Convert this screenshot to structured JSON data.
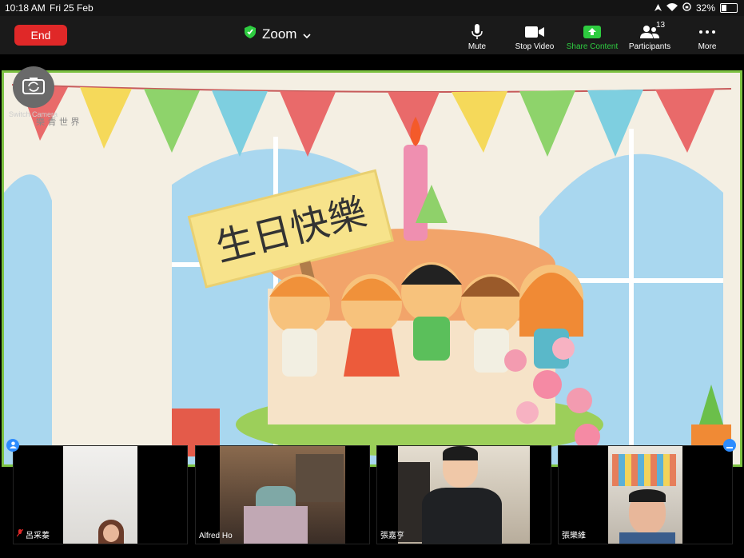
{
  "status": {
    "time": "10:18 AM",
    "date": "Fri 25 Feb",
    "battery": "32%"
  },
  "toolbar": {
    "end_label": "End",
    "title": "Zoom",
    "mute_label": "Mute",
    "stop_video_label": "Stop Video",
    "share_label": "Share Content",
    "participants_label": "Participants",
    "participants_count": "13",
    "more_label": "More"
  },
  "main": {
    "switch_camera_label": "Switch Camera",
    "watermark": "樂 青 世 界",
    "sign_text": "生日快樂"
  },
  "participants": [
    {
      "name": "呂采蓁",
      "muted": true
    },
    {
      "name": "Alfred Ho",
      "muted": false
    },
    {
      "name": "張嘉亨",
      "muted": false
    },
    {
      "name": "張樂維",
      "muted": false
    }
  ],
  "colors": {
    "accent": "#2ecc40",
    "end": "#e02828",
    "active_border": "#7dc242",
    "pin": "#2d8cff"
  }
}
